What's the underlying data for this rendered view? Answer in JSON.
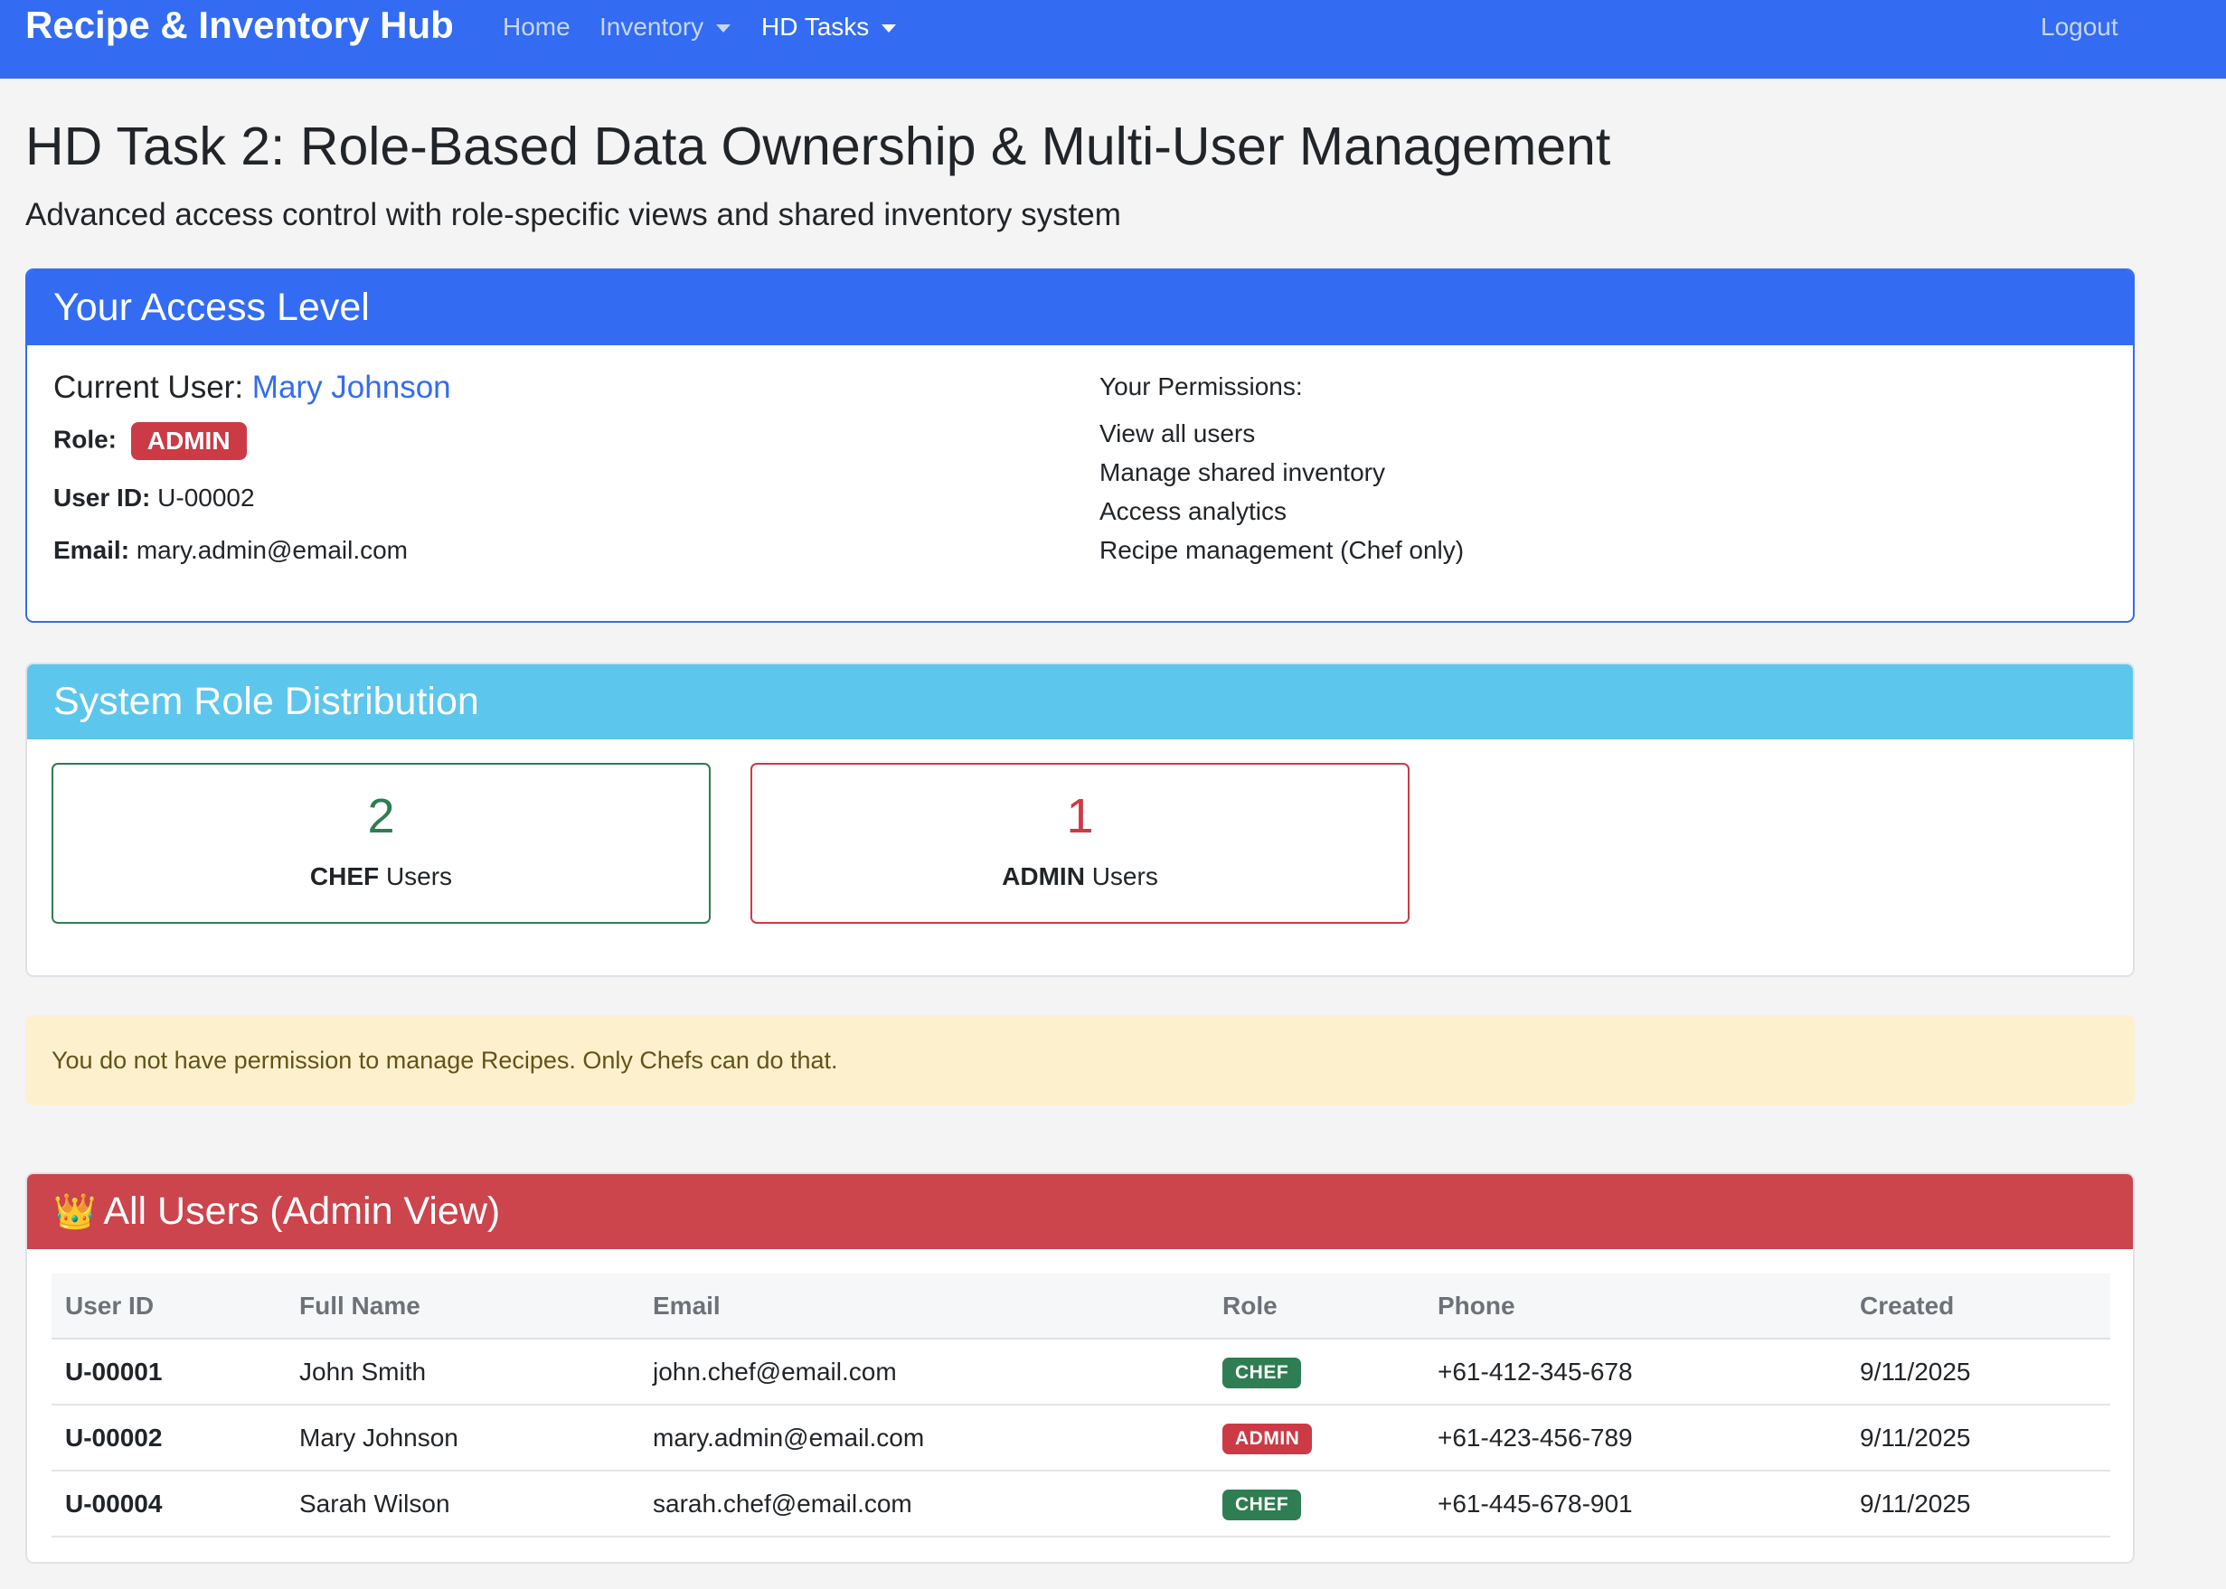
{
  "navbar": {
    "brand": "Recipe & Inventory Hub",
    "links": [
      {
        "label": "Home"
      },
      {
        "label": "Inventory"
      },
      {
        "label": "HD Tasks"
      }
    ],
    "logout": "Logout",
    "color": "#336cf2"
  },
  "page": {
    "title": "HD Task 2: Role-Based Data Ownership & Multi-User Management",
    "lead": "Advanced access control with role-specific views and shared inventory system"
  },
  "access": {
    "header": "Your Access Level",
    "current_user_label": "Current User:",
    "current_user_name": "Mary Johnson",
    "role_label": "Role:",
    "role_value": "ADMIN",
    "user_id_label": "User ID:",
    "user_id_value": "U-00002",
    "email_label": "Email:",
    "email_value": "mary.admin@email.com",
    "permissions_heading": "Your Permissions:",
    "permissions": [
      "View all users",
      "Manage shared inventory",
      "Access analytics",
      "Recipe management (Chef only)"
    ]
  },
  "distribution": {
    "header": "System Role Distribution",
    "stats": [
      {
        "count": "2",
        "role": "CHEF",
        "suffix": "Users"
      },
      {
        "count": "1",
        "role": "ADMIN",
        "suffix": "Users"
      }
    ]
  },
  "alert": {
    "text": "You do not have permission to manage Recipes. Only Chefs can do that."
  },
  "users": {
    "header": "All Users (Admin View)",
    "header_icon": "crown-icon",
    "columns": [
      "User ID",
      "Full Name",
      "Email",
      "Role",
      "Phone",
      "Created"
    ],
    "rows": [
      {
        "id": "U-00001",
        "name": "John Smith",
        "email": "john.chef@email.com",
        "role": "CHEF",
        "phone": "+61-412-345-678",
        "created": "9/11/2025"
      },
      {
        "id": "U-00002",
        "name": "Mary Johnson",
        "email": "mary.admin@email.com",
        "role": "ADMIN",
        "phone": "+61-423-456-789",
        "created": "9/11/2025"
      },
      {
        "id": "U-00004",
        "name": "Sarah Wilson",
        "email": "sarah.chef@email.com",
        "role": "CHEF",
        "phone": "+61-445-678-901",
        "created": "9/11/2025"
      }
    ]
  }
}
